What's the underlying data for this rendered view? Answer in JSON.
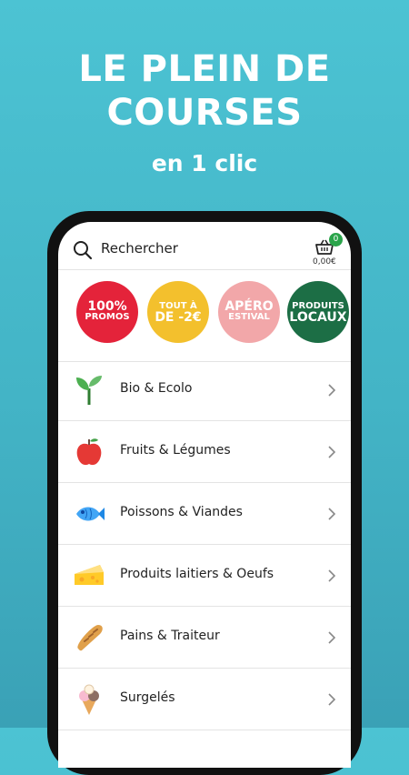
{
  "hero": {
    "line1": "LE PLEIN DE",
    "line2": "COURSES",
    "line3": "en 1 clic"
  },
  "search": {
    "placeholder": "Rechercher"
  },
  "cart": {
    "count": "0",
    "total": "0,00€"
  },
  "promos": [
    {
      "l1": "100%",
      "l2": "PROMOS",
      "color": "#e4233a"
    },
    {
      "l1": "TOUT À",
      "l2": "DE -2€",
      "color": "#f3c02d"
    },
    {
      "l1": "APÉRO",
      "l2": "ESTIVAL",
      "color": "#f2a7a9"
    },
    {
      "l1": "PRODUITS",
      "l2": "LOCAUX",
      "color": "#1c6e45"
    }
  ],
  "categories": [
    {
      "label": "Bio & Ecolo",
      "icon": "sprout-icon"
    },
    {
      "label": "Fruits & Légumes",
      "icon": "apple-icon"
    },
    {
      "label": "Poissons & Viandes",
      "icon": "fish-icon"
    },
    {
      "label": "Produits laitiers & Oeufs",
      "icon": "cheese-icon"
    },
    {
      "label": "Pains & Traiteur",
      "icon": "bread-icon"
    },
    {
      "label": "Surgelés",
      "icon": "ice-cream-icon"
    }
  ]
}
